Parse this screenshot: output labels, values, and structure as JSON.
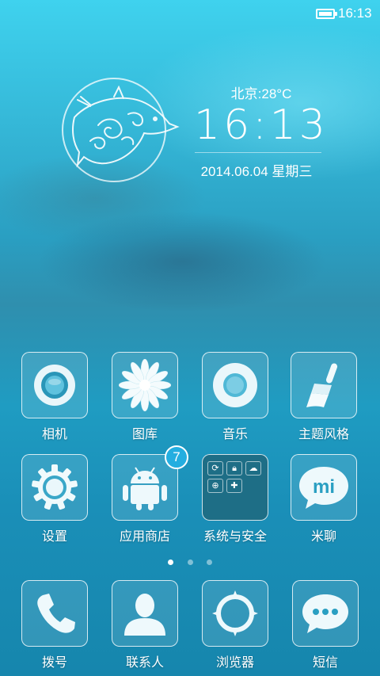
{
  "status_bar": {
    "time": "16:13",
    "battery_icon": "battery-icon"
  },
  "clock_widget": {
    "weather": "北京:28°C",
    "time": "16:13",
    "date": "2014.06.04 星期三",
    "image_icon": "dolphin-icon"
  },
  "apps": [
    {
      "label": "相机",
      "icon": "camera-icon"
    },
    {
      "label": "图库",
      "icon": "gallery-flower-icon"
    },
    {
      "label": "音乐",
      "icon": "music-ring-icon"
    },
    {
      "label": "主题风格",
      "icon": "brush-icon"
    },
    {
      "label": "设置",
      "icon": "gear-icon"
    },
    {
      "label": "应用商店",
      "icon": "android-icon",
      "badge": "7"
    },
    {
      "label": "系统与安全",
      "icon": "folder-icon"
    },
    {
      "label": "米聊",
      "icon": "mi-chat-icon",
      "text": "mi"
    }
  ],
  "dock": [
    {
      "label": "拨号",
      "icon": "phone-icon"
    },
    {
      "label": "联系人",
      "icon": "contact-icon"
    },
    {
      "label": "浏览器",
      "icon": "browser-icon"
    },
    {
      "label": "短信",
      "icon": "message-icon"
    }
  ],
  "page_indicator": {
    "pages": 3,
    "active_index": 0
  }
}
